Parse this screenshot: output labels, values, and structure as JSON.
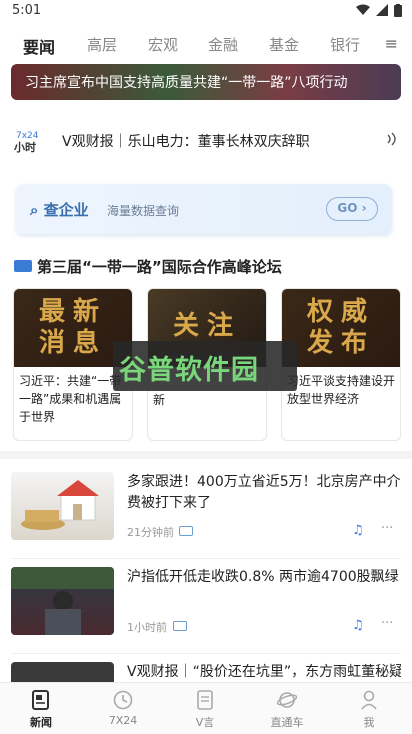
{
  "status": {
    "time": "5:01"
  },
  "tabs": [
    {
      "label": "要闻",
      "active": true
    },
    {
      "label": "高层"
    },
    {
      "label": "宏观"
    },
    {
      "label": "金融"
    },
    {
      "label": "基金"
    },
    {
      "label": "银行"
    }
  ],
  "tabs_more_icon": "menu-icon",
  "banner": {
    "text": "习主席宣布中国支持高质量共建“一带一路”八项行动"
  },
  "ticker": {
    "logo_text": "7×24 小时",
    "text": "V观财报｜乐山电力：董事长林双庆辞职"
  },
  "qcc": {
    "logo": "查企业",
    "subtitle": "海量数据查询",
    "go_label": "GO"
  },
  "section": {
    "tag_icon": "special-topic-icon",
    "title": "第三届“一带一路”国际合作高峰论坛"
  },
  "cards": [
    {
      "image_text": "最新消息",
      "text": "习近平：共建“一带一路”成果和机遇属于世界"
    },
    {
      "image_text": "关注",
      "text": "新"
    },
    {
      "image_text": "权威发布",
      "text": "习近平谈支持建设开放型世界经济"
    }
  ],
  "watermark": {
    "text": "谷普软件园"
  },
  "feed": [
    {
      "title": "多家跟进！400万立省近5万！北京房产中介费被打下来了",
      "time": "21分钟前"
    },
    {
      "title": "沪指低开低走收跌0.8% 两市逾4700股飘绿",
      "time": "1小时前"
    },
    {
      "title": "V观财报｜“股价还在坑里”，东方雨虹董秘疑",
      "time": ""
    }
  ],
  "bottom_nav": [
    {
      "label": "新闻",
      "icon": "news-icon",
      "active": true
    },
    {
      "label": "7X24",
      "icon": "clock-icon"
    },
    {
      "label": "V言",
      "icon": "document-icon"
    },
    {
      "label": "直通车",
      "icon": "planet-icon"
    },
    {
      "label": "我",
      "icon": "user-icon"
    }
  ],
  "colors": {
    "accent": "#3a7bd5",
    "qcc_blue": "#3a6fae",
    "watermark_green": "#7ad67a"
  }
}
